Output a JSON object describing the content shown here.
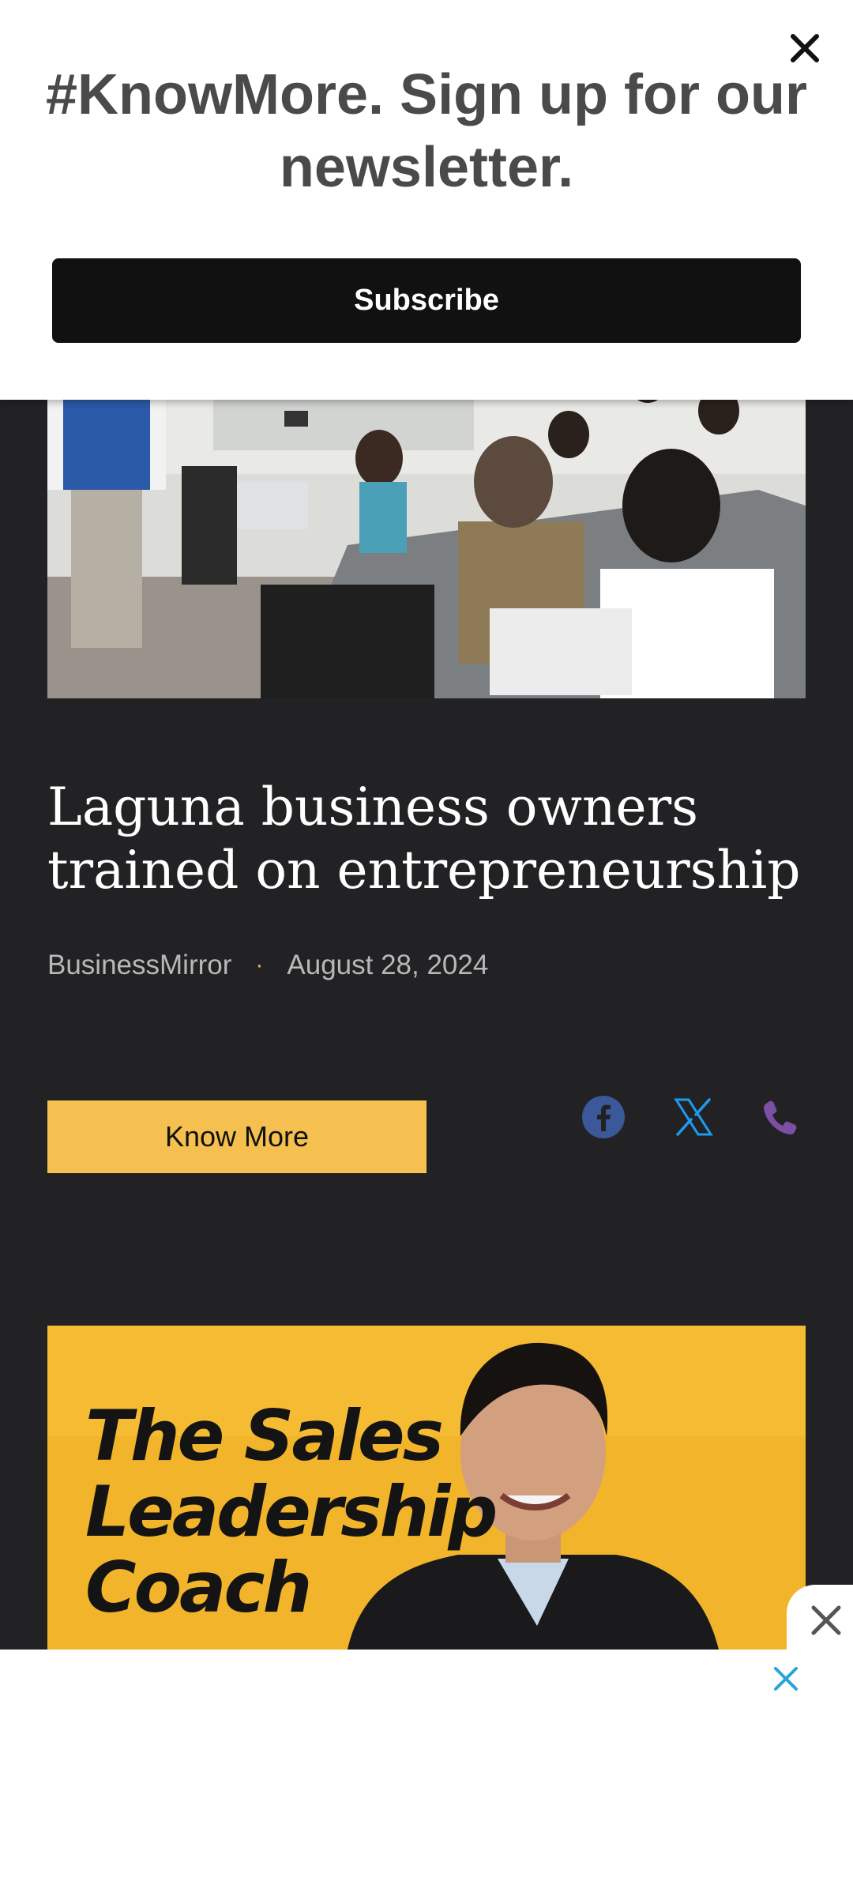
{
  "newsletter": {
    "title": "#KnowMore. Sign up for our newsletter.",
    "subscribe_label": "Subscribe",
    "close_icon": "close-icon"
  },
  "article": {
    "title": "Laguna business owners trained on entrepreneurship",
    "source": "BusinessMirror",
    "separator": "·",
    "date": "August 28, 2024",
    "know_more_label": "Know More",
    "share_icons": [
      "facebook-icon",
      "x-icon",
      "phone-icon"
    ]
  },
  "promo": {
    "text": "The Sales\nLeadership\nCoach",
    "close_icon": "close-icon"
  },
  "ad": {
    "close_icon": "close-icon"
  },
  "colors": {
    "background": "#222224",
    "accent": "#f5c04f",
    "facebook": "#3b5998",
    "x": "#1d9bf0",
    "phone": "#7b4fa3"
  }
}
